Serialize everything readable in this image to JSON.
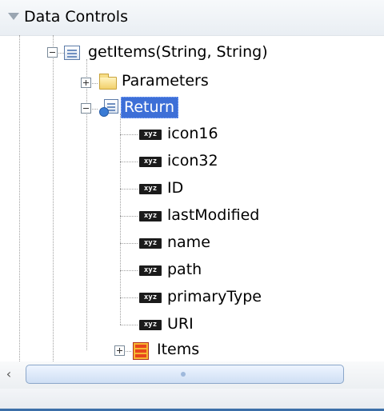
{
  "panel": {
    "title": "Data Controls"
  },
  "tree": {
    "method": "getItems(String, String)",
    "parameters": "Parameters",
    "return": "Return",
    "attributes": [
      "icon16",
      "icon32",
      "ID",
      "lastModified",
      "name",
      "path",
      "primaryType",
      "URI"
    ],
    "items": "Items"
  },
  "icons": {
    "attribute_badge": "xyz",
    "header_toggle": "collapse-triangle-icon"
  },
  "colors": {
    "selection": "#3d6fd7",
    "bottom_accent": "#3c6fa8"
  }
}
